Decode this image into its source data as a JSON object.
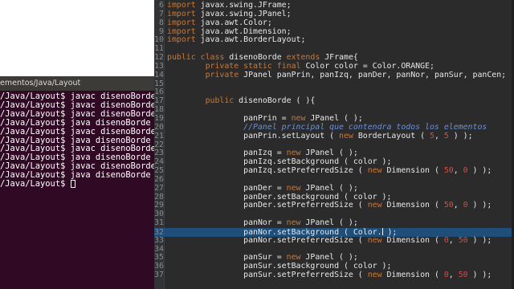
{
  "terminal": {
    "title": "ementos/Java/Layout",
    "lines": [
      "/Java/Layout$ javac disenoBorde.j",
      "/Java/Layout$ javac disenoBorde.j",
      "/Java/Layout$ javac disenoBorde.j",
      "/Java/Layout$ java disenoBorde",
      "/Java/Layout$ javac disenoBorde.j",
      "/Java/Layout$ java disenoBorde",
      "/Java/Layout$ javac disenoBorde.j",
      "/Java/Layout$ java disenoBorde",
      "/Java/Layout$ javac disenoBorde.j",
      "/Java/Layout$ java disenoBorde",
      "/Java/Layout$ "
    ]
  },
  "editor": {
    "current_line": "32",
    "lines": [
      {
        "n": "6",
        "t": "import javax.swing.JFrame;"
      },
      {
        "n": "7",
        "t": "import javax.swing.JPanel;"
      },
      {
        "n": "8",
        "t": "import java.awt.Color;"
      },
      {
        "n": "9",
        "t": "import java.awt.Dimension;"
      },
      {
        "n": "10",
        "t": "import java.awt.BorderLayout;"
      },
      {
        "n": "11",
        "t": ""
      },
      {
        "n": "12",
        "t": "public class disenoBorde extends JFrame{"
      },
      {
        "n": "13",
        "t": "        private static final Color color = Color.ORANGE;"
      },
      {
        "n": "14",
        "t": "        private JPanel panPrin, panIzq, panDer, panNor, panSur, panCen;"
      },
      {
        "n": "15",
        "t": ""
      },
      {
        "n": "16",
        "t": ""
      },
      {
        "n": "17",
        "t": "        public disenoBorde ( ){"
      },
      {
        "n": "18",
        "t": ""
      },
      {
        "n": "19",
        "t": "                panPrin = new JPanel ( );"
      },
      {
        "n": "20",
        "t": "                //Panel principal que contendra todos los elementos"
      },
      {
        "n": "21",
        "t": "                panPrin.setLayout ( new BorderLayout ( 5, 5 ) );"
      },
      {
        "n": "22",
        "t": ""
      },
      {
        "n": "23",
        "t": "                panIzq = new JPanel ( );"
      },
      {
        "n": "24",
        "t": "                panIzq.setBackground ( color );"
      },
      {
        "n": "25",
        "t": "                panIzq.setPreferredSize ( new Dimension ( 50, 0 ) );"
      },
      {
        "n": "26",
        "t": ""
      },
      {
        "n": "27",
        "t": "                panDer = new JPanel ( );"
      },
      {
        "n": "28",
        "t": "                panDer.setBackground ( color );"
      },
      {
        "n": "29",
        "t": "                panDer.setPreferredSize ( new Dimension ( 50, 0 ) );"
      },
      {
        "n": "30",
        "t": ""
      },
      {
        "n": "31",
        "t": "                panNor = new JPanel ( );"
      },
      {
        "n": "32",
        "t": "                panNor.setBackground ( Color.| );"
      },
      {
        "n": "33",
        "t": "                panNor.setPreferredSize ( new Dimension ( 0, 50 ) );"
      },
      {
        "n": "34",
        "t": ""
      },
      {
        "n": "35",
        "t": "                panSur = new JPanel ( );"
      },
      {
        "n": "36",
        "t": "                panSur.setBackground ( color );"
      },
      {
        "n": "37",
        "t": "                panSur.setPreferredSize ( new Dimension ( 0, 50 ) );"
      }
    ]
  }
}
